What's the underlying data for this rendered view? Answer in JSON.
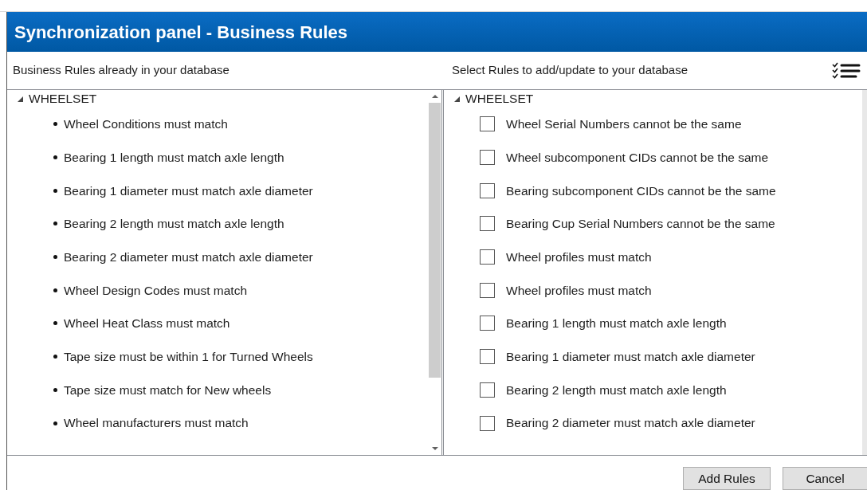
{
  "window": {
    "title": "Synchronization panel - Business Rules"
  },
  "left_panel": {
    "heading": "Business Rules already in your database",
    "tree": [
      {
        "label": "WHEELSET",
        "expanded": true,
        "children": [
          {
            "label": "Wheel Conditions must match"
          },
          {
            "label": "Bearing 1 length must match axle length"
          },
          {
            "label": "Bearing 1 diameter must match axle diameter"
          },
          {
            "label": "Bearing 2 length must match axle length"
          },
          {
            "label": "Bearing 2 diameter must match axle diameter"
          },
          {
            "label": "Wheel Design Codes must match"
          },
          {
            "label": "Wheel Heat Class must match"
          },
          {
            "label": "Tape size must be within 1 for Turned Wheels"
          },
          {
            "label": "Tape size must match for New wheels"
          },
          {
            "label": "Wheel manufacturers must match"
          }
        ]
      }
    ]
  },
  "right_panel": {
    "heading": "Select Rules to add/update to your database",
    "tree": [
      {
        "label": "WHEELSET",
        "expanded": true,
        "children": [
          {
            "label": "Wheel Serial Numbers cannot be the same",
            "checked": false
          },
          {
            "label": "Wheel subcomponent CIDs cannot be the same",
            "checked": false
          },
          {
            "label": "Bearing subcomponent CIDs cannot be the same",
            "checked": false
          },
          {
            "label": "Bearing Cup Serial Numbers cannot be the same",
            "checked": false
          },
          {
            "label": "Wheel profiles must match",
            "checked": false
          },
          {
            "label": "Wheel profiles must match",
            "checked": false
          },
          {
            "label": "Bearing 1 length must match axle length",
            "checked": false
          },
          {
            "label": "Bearing 1 diameter must match axle diameter",
            "checked": false
          },
          {
            "label": "Bearing 2 length must match axle length",
            "checked": false
          },
          {
            "label": "Bearing 2 diameter must match axle diameter",
            "checked": false
          }
        ]
      }
    ]
  },
  "buttons": [
    "Add Rules",
    "Cancel"
  ]
}
